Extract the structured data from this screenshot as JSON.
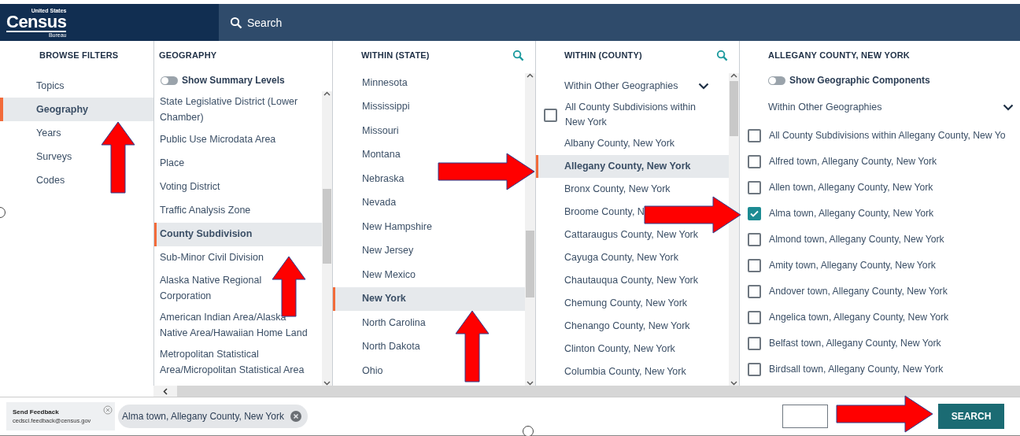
{
  "header": {
    "logo": {
      "top": "United States",
      "main": "Census",
      "bottom": "Bureau"
    },
    "search_placeholder": "Search"
  },
  "browse_filters": {
    "title": "BROWSE FILTERS",
    "items": [
      {
        "label": "Topics",
        "selected": false
      },
      {
        "label": "Geography",
        "selected": true
      },
      {
        "label": "Years",
        "selected": false
      },
      {
        "label": "Surveys",
        "selected": false
      },
      {
        "label": "Codes",
        "selected": false
      }
    ]
  },
  "geography": {
    "title": "GEOGRAPHY",
    "toggle": {
      "label": "Show Summary Levels",
      "on": false
    },
    "items": [
      {
        "label": "State Legislative District (Lower Chamber)",
        "selected": false
      },
      {
        "label": "Public Use Microdata Area",
        "selected": false
      },
      {
        "label": "Place",
        "selected": false
      },
      {
        "label": "Voting District",
        "selected": false
      },
      {
        "label": "Traffic Analysis Zone",
        "selected": false
      },
      {
        "label": "County Subdivision",
        "selected": true
      },
      {
        "label": "Sub-Minor Civil Division",
        "selected": false
      },
      {
        "label": "Alaska Native Regional Corporation",
        "selected": false
      },
      {
        "label": "American Indian Area/Alaska Native Area/Hawaiian Home Land",
        "selected": false
      },
      {
        "label": "Metropolitan Statistical Area/Micropolitan Statistical Area",
        "selected": false
      }
    ]
  },
  "within_state": {
    "title": "WITHIN (STATE)",
    "items": [
      {
        "label": "Minnesota",
        "selected": false
      },
      {
        "label": "Mississippi",
        "selected": false
      },
      {
        "label": "Missouri",
        "selected": false
      },
      {
        "label": "Montana",
        "selected": false
      },
      {
        "label": "Nebraska",
        "selected": false
      },
      {
        "label": "Nevada",
        "selected": false
      },
      {
        "label": "New Hampshire",
        "selected": false
      },
      {
        "label": "New Jersey",
        "selected": false
      },
      {
        "label": "New Mexico",
        "selected": false
      },
      {
        "label": "New York",
        "selected": true
      },
      {
        "label": "North Carolina",
        "selected": false
      },
      {
        "label": "North Dakota",
        "selected": false
      },
      {
        "label": "Ohio",
        "selected": false
      }
    ]
  },
  "within_county": {
    "title": "WITHIN (COUNTY)",
    "dropdown": "Within Other Geographies",
    "items": [
      {
        "kind": "checkbox",
        "label": "All County Subdivisions within New York",
        "checked": false
      },
      {
        "kind": "option",
        "label": "Albany County, New York",
        "selected": false
      },
      {
        "kind": "option",
        "label": "Allegany County, New York",
        "selected": true
      },
      {
        "kind": "option",
        "label": "Bronx County, New York",
        "selected": false
      },
      {
        "kind": "option",
        "label": "Broome County, N",
        "selected": false
      },
      {
        "kind": "option",
        "label": "Cattaraugus County, New York",
        "selected": false
      },
      {
        "kind": "option",
        "label": "Cayuga County, New York",
        "selected": false
      },
      {
        "kind": "option",
        "label": "Chautauqua County, New York",
        "selected": false
      },
      {
        "kind": "option",
        "label": "Chemung County, New York",
        "selected": false
      },
      {
        "kind": "option",
        "label": "Chenango County, New York",
        "selected": false
      },
      {
        "kind": "option",
        "label": "Clinton County, New York",
        "selected": false
      },
      {
        "kind": "option",
        "label": "Columbia County, New York",
        "selected": false
      }
    ]
  },
  "allegany": {
    "title": "ALLEGANY COUNTY, NEW YORK",
    "toggle": {
      "label": "Show Geographic Components",
      "on": false
    },
    "dropdown": "Within Other Geographies",
    "items": [
      {
        "label": "All County Subdivisions within Allegany County, New Yo",
        "checked": false
      },
      {
        "label": "Alfred town, Allegany County, New York",
        "checked": false
      },
      {
        "label": "Allen town, Allegany County, New York",
        "checked": false
      },
      {
        "label": "Alma town, Allegany County, New York",
        "checked": true
      },
      {
        "label": "Almond town, Allegany County, New York",
        "checked": false
      },
      {
        "label": "Amity town, Allegany County, New York",
        "checked": false
      },
      {
        "label": "Andover town, Allegany County, New York",
        "checked": false
      },
      {
        "label": "Angelica town, Allegany County, New York",
        "checked": false
      },
      {
        "label": "Belfast town, Allegany County, New York",
        "checked": false
      },
      {
        "label": "Birdsall town, Allegany County, New York",
        "checked": false
      }
    ]
  },
  "feedback": {
    "title": "Send Feedback",
    "email": "cedsci.feedback@census.gov"
  },
  "selected_chips": [
    "Alma town, Allegany County, New York"
  ],
  "search_button": "SEARCH"
}
